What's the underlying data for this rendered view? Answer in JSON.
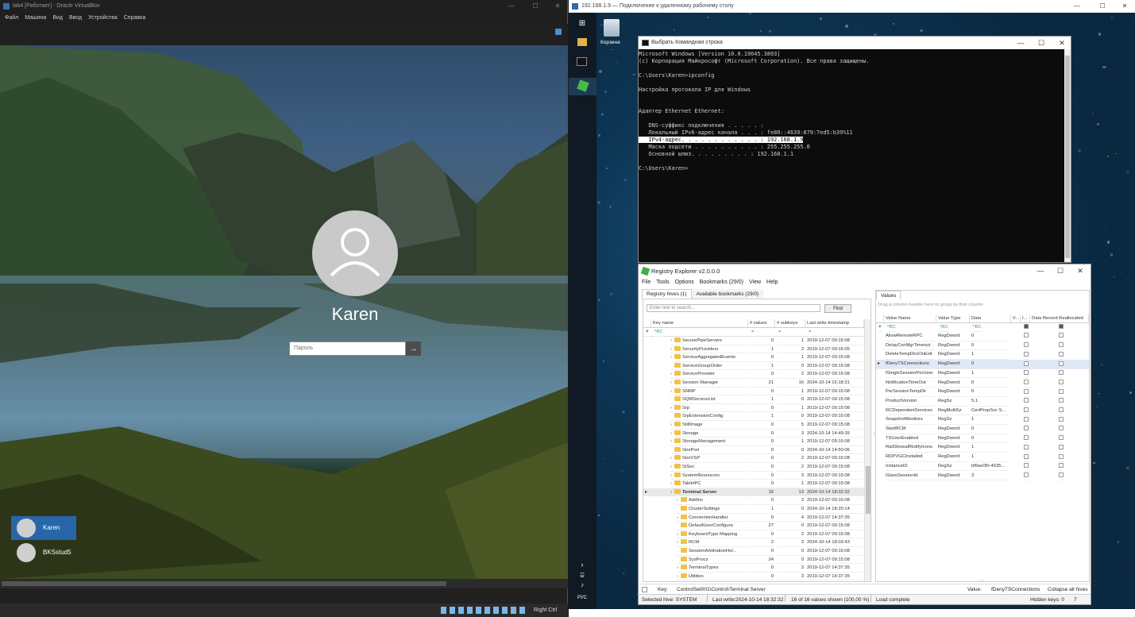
{
  "vbox": {
    "title": "lab4 [Работает] - Oracle VirtualBox",
    "menu": [
      "Файл",
      "Машина",
      "Вид",
      "Ввод",
      "Устройства",
      "Справка"
    ],
    "login": {
      "username": "Karen",
      "password_placeholder": "Пароль"
    },
    "users": [
      "Karen",
      "BKSstud5"
    ],
    "status_right": "Right Ctrl"
  },
  "rdp": {
    "title": "192.168.1.9 — Подключение к удаленному рабочему столу",
    "desktop_icon": "Корзина",
    "tray_lang": "РУС"
  },
  "cmd": {
    "title": "Выбрать Командная строка",
    "lines": [
      "Microsoft Windows [Version 10.0.19045.3803]",
      "(c) Корпорация Майкрософт (Microsoft Corporation). Все права защищены.",
      "",
      "C:\\Users\\Karen>ipconfig",
      "",
      "Настройка протокола IP для Windows",
      "",
      "",
      "Адаптер Ethernet Ethernet:",
      "",
      "   DNS-суффикс подключения . . . . . :",
      "   Локальный IPv6-адрес канала . . . : fe80::4639:879:7ed5:b39%11",
      "   IPv4-адрес. . . . . . . . . . . . : 192.168.1.9",
      "   Маска подсети . . . . . . . . . . : 255.255.255.0",
      "   Основной шлюз. . . . . . . . . : 192.168.1.1",
      "",
      "C:\\Users\\Karen>"
    ]
  },
  "reg": {
    "title": "Registry Explorer v2.0.0.0",
    "menu": [
      "File",
      "Tools",
      "Options",
      "Bookmarks (29/0)",
      "View",
      "Help"
    ],
    "tabs": [
      "Registry hives (1)",
      "Available bookmarks (29/0)"
    ],
    "search_placeholder": "Enter text to search...",
    "find_label": "Find",
    "key_columns": [
      "Key name",
      "# values",
      "# subkeys",
      "Last write timestamp"
    ],
    "keys": [
      {
        "name": "SecurePipeServers",
        "values": "0",
        "subkeys": "1",
        "ts": "2019-12-07 09:15:08",
        "lvl": 1,
        "exp": true
      },
      {
        "name": "SecurityProviders",
        "values": "1",
        "subkeys": "3",
        "ts": "2019-12-07 09:16:05",
        "lvl": 1,
        "exp": true
      },
      {
        "name": "ServiceAggregatedEvents",
        "values": "0",
        "subkeys": "1",
        "ts": "2019-12-07 09:15:08",
        "lvl": 1,
        "exp": true
      },
      {
        "name": "ServiceGroupOrder",
        "values": "1",
        "subkeys": "0",
        "ts": "2019-12-07 09:15:08",
        "lvl": 1,
        "exp": false
      },
      {
        "name": "ServiceProvider",
        "values": "0",
        "subkeys": "2",
        "ts": "2019-12-07 09:15:08",
        "lvl": 1,
        "exp": true
      },
      {
        "name": "Session Manager",
        "values": "21",
        "subkeys": "16",
        "ts": "2024-10-14 15:18:31",
        "lvl": 1,
        "exp": true
      },
      {
        "name": "SNMP",
        "values": "0",
        "subkeys": "1",
        "ts": "2019-12-07 09:15:08",
        "lvl": 1,
        "exp": true
      },
      {
        "name": "SQMServiceList",
        "values": "1",
        "subkeys": "0",
        "ts": "2019-12-07 09:15:08",
        "lvl": 1,
        "exp": false
      },
      {
        "name": "Srp",
        "values": "0",
        "subkeys": "1",
        "ts": "2019-12-07 09:15:08",
        "lvl": 1,
        "exp": true
      },
      {
        "name": "SrpExtensionConfig",
        "values": "1",
        "subkeys": "0",
        "ts": "2019-12-07 09:15:08",
        "lvl": 1,
        "exp": false
      },
      {
        "name": "StillImage",
        "values": "0",
        "subkeys": "5",
        "ts": "2019-12-07 09:15:08",
        "lvl": 1,
        "exp": true
      },
      {
        "name": "Storage",
        "values": "0",
        "subkeys": "3",
        "ts": "2024-10-14 14:49:35",
        "lvl": 1,
        "exp": true
      },
      {
        "name": "StorageManagement",
        "values": "0",
        "subkeys": "1",
        "ts": "2019-12-07 09:15:08",
        "lvl": 1,
        "exp": true
      },
      {
        "name": "StorPort",
        "values": "0",
        "subkeys": "0",
        "ts": "2024-10-14 14:50:06",
        "lvl": 1,
        "exp": false
      },
      {
        "name": "StorVSP",
        "values": "0",
        "subkeys": "2",
        "ts": "2019-12-07 09:15:08",
        "lvl": 1,
        "exp": true
      },
      {
        "name": "StSec",
        "values": "0",
        "subkeys": "2",
        "ts": "2019-12-07 09:15:08",
        "lvl": 1,
        "exp": true
      },
      {
        "name": "SystemResources",
        "values": "0",
        "subkeys": "3",
        "ts": "2019-12-07 09:15:08",
        "lvl": 1,
        "exp": true
      },
      {
        "name": "TabletPC",
        "values": "0",
        "subkeys": "1",
        "ts": "2019-12-07 09:15:08",
        "lvl": 1,
        "exp": true
      },
      {
        "name": "Terminal Server",
        "values": "16",
        "subkeys": "13",
        "ts": "2024-10-14 18:32:32",
        "lvl": 1,
        "exp": true,
        "selected": true
      },
      {
        "name": "AddIns",
        "values": "0",
        "subkeys": "3",
        "ts": "2019-12-07 09:15:08",
        "lvl": 2,
        "exp": true
      },
      {
        "name": "ClusterSettings",
        "values": "1",
        "subkeys": "0",
        "ts": "2024-10-14 18:20:14",
        "lvl": 2,
        "exp": false
      },
      {
        "name": "ConnectionHandler",
        "values": "0",
        "subkeys": "4",
        "ts": "2019-12-07 14:37:35",
        "lvl": 2,
        "exp": true
      },
      {
        "name": "DefaultUserConfigura",
        "values": "27",
        "subkeys": "0",
        "ts": "2019-12-07 09:15:08",
        "lvl": 2,
        "exp": false
      },
      {
        "name": "KeyboardType Mapping",
        "values": "0",
        "subkeys": "2",
        "ts": "2019-12-07 09:15:08",
        "lvl": 2,
        "exp": true
      },
      {
        "name": "RCM",
        "values": "2",
        "subkeys": "3",
        "ts": "2024-10-14 18:03:43",
        "lvl": 2,
        "exp": true
      },
      {
        "name": "SessionArbitrationHel...",
        "values": "0",
        "subkeys": "0",
        "ts": "2019-12-07 09:15:08",
        "lvl": 2,
        "exp": false
      },
      {
        "name": "SysProcs",
        "values": "24",
        "subkeys": "0",
        "ts": "2019-12-07 09:15:08",
        "lvl": 2,
        "exp": false
      },
      {
        "name": "TerminalTypes",
        "values": "0",
        "subkeys": "3",
        "ts": "2019-12-07 14:37:35",
        "lvl": 2,
        "exp": true
      },
      {
        "name": "Utilities",
        "values": "0",
        "subkeys": "3",
        "ts": "2019-12-07 14:37:35",
        "lvl": 2,
        "exp": true
      }
    ],
    "values_tab": "Values",
    "values_drag_hint": "Drag a column header here to group by that column",
    "value_columns": [
      "Value Name",
      "Value Type",
      "Data",
      "V...",
      "I...",
      "Data Record Reallocated"
    ],
    "values": [
      {
        "name": "AllowRemoteRPC",
        "type": "RegDword",
        "data": "0"
      },
      {
        "name": "DelayConMgrTimeout",
        "type": "RegDword",
        "data": "0"
      },
      {
        "name": "DeleteTempDirsOnExit",
        "type": "RegDword",
        "data": "1"
      },
      {
        "name": "fDenyTSConnections",
        "type": "RegDword",
        "data": "0",
        "selected": true
      },
      {
        "name": "fSingleSessionPerUser",
        "type": "RegDword",
        "data": "1"
      },
      {
        "name": "NotificationTimeOut",
        "type": "RegDword",
        "data": "0"
      },
      {
        "name": "PerSessionTempDir",
        "type": "RegDword",
        "data": "0"
      },
      {
        "name": "ProductVersion",
        "type": "RegSz",
        "data": "5.1"
      },
      {
        "name": "RCDependentServices",
        "type": "RegMultiSz",
        "data": "CertPropSvc S..."
      },
      {
        "name": "SnapshotMonitors",
        "type": "RegSz",
        "data": "1"
      },
      {
        "name": "StartRCM",
        "type": "RegDword",
        "data": "0"
      },
      {
        "name": "TSUserEnabled",
        "type": "RegDword",
        "data": "0"
      },
      {
        "name": "RailShowallNotifyIcons",
        "type": "RegDword",
        "data": "1"
      },
      {
        "name": "RDPVGCInstalled",
        "type": "RegDword",
        "data": "1"
      },
      {
        "name": "InstanceID",
        "type": "RegSz",
        "data": "bf6ee0f0-4635..."
      },
      {
        "name": "GlassSessionId",
        "type": "RegDword",
        "data": "3"
      }
    ],
    "key_bar": {
      "label": "Key:",
      "path": "ControlSet001\\Control\\Terminal Server",
      "value_label": "Value:",
      "value": "fDenyTSConnections",
      "collapse": "Collapse all hives"
    },
    "status": {
      "hive": "Selected hive: SYSTEM",
      "lw_label": "Last write:",
      "lw": "2024-10-14 18:32:32",
      "shown": "16 of 16 values shown (100,00 %)",
      "load": "Load complete",
      "hidden": "Hidden keys: 0",
      "num": "7"
    }
  }
}
